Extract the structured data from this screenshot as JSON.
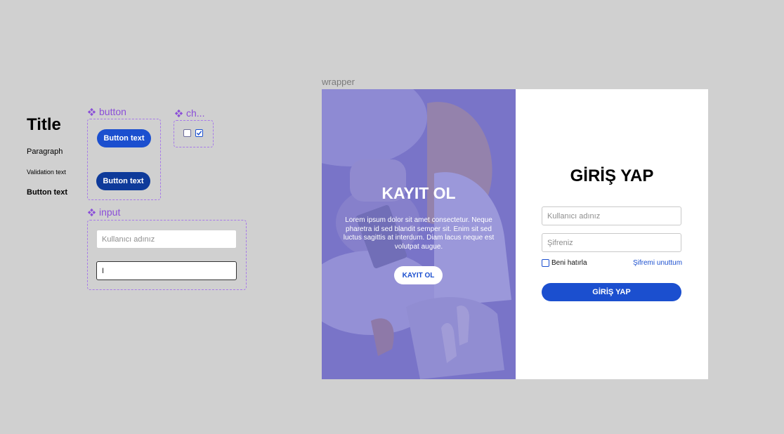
{
  "style_guide": {
    "title": "Title",
    "paragraph": "Paragraph",
    "validation": "Validation text",
    "button_text": "Button text"
  },
  "components": {
    "button": {
      "label": "button",
      "primary": "Button text",
      "dark": "Button text"
    },
    "checkbox": {
      "label": "ch..."
    },
    "input": {
      "label": "input",
      "placeholder": "Kullanıcı adınız",
      "focused_value": "I"
    }
  },
  "wrapper": {
    "label": "wrapper",
    "hero": {
      "title": "KAYIT OL",
      "text": "Lorem ipsum dolor sit amet consectetur. Neque pharetra id sed blandit semper sit. Enim sit sed luctus sagittis at interdum. Diam lacus neque est volutpat augue.",
      "button": "KAYIT OL"
    },
    "login": {
      "title": "GİRİŞ YAP",
      "username_placeholder": "Kullanıcı adınız",
      "password_placeholder": "Şifreniz",
      "remember": "Beni hatırla",
      "forgot": "Şifremi unuttum",
      "submit": "GİRİŞ YAP"
    }
  },
  "colors": {
    "primary": "#1b4fcf",
    "primary_dark": "#0e3a9a",
    "component_purple": "#8b4fd8",
    "hero_overlay": "#5c58c8",
    "canvas": "#d0d0d0"
  }
}
